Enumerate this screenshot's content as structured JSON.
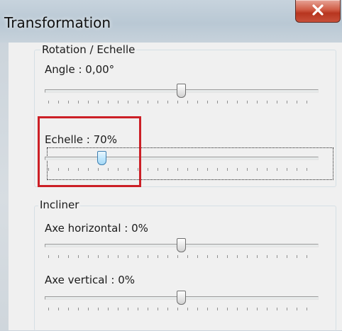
{
  "window": {
    "title": "Transformation"
  },
  "rotation_group": {
    "label": "Rotation / Echelle",
    "angle": {
      "label": "Angle : 0,00°",
      "level": 0.5
    },
    "scale": {
      "label": "Echelle : 70%",
      "level": 0.2
    }
  },
  "skew_group": {
    "label": "Incliner",
    "horizontal": {
      "label": "Axe horizontal : 0%",
      "level": 0.5
    },
    "vertical": {
      "label": "Axe vertical : 0%",
      "level": 0.5
    }
  },
  "colors": {
    "highlight": "#cc1f26",
    "close_button": "#c8503a",
    "active_thumb": "#bee6fd"
  },
  "icons": {
    "close": "close-icon"
  }
}
